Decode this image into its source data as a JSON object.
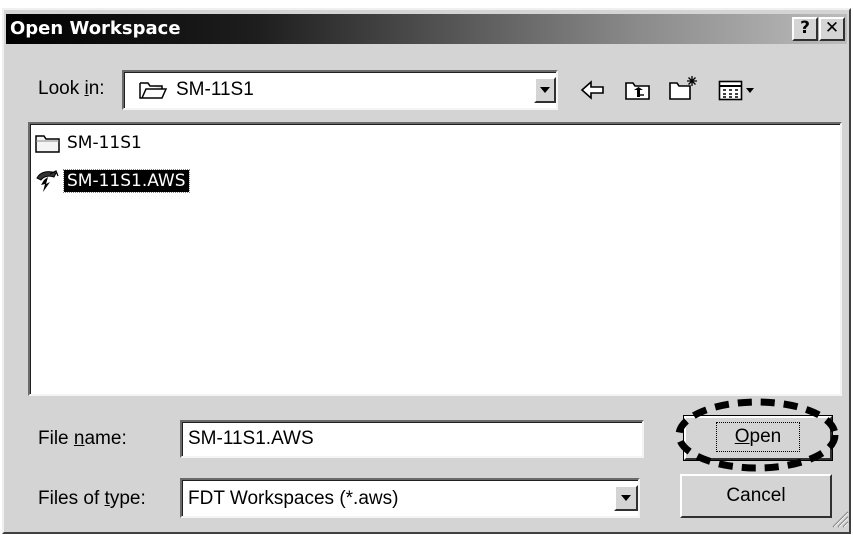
{
  "window": {
    "title": "Open Workspace",
    "help_button": "?",
    "close_button": "✕"
  },
  "lookin": {
    "label_pre": "Look ",
    "label_hot": "i",
    "label_post": "n:",
    "value": "SM-11S1"
  },
  "files": [
    {
      "name": "SM-11S1",
      "icon": "folder-icon",
      "selected": false
    },
    {
      "name": "SM-11S1.AWS",
      "icon": "workspace-file-icon",
      "selected": true
    }
  ],
  "filename": {
    "label_pre": "File ",
    "label_hot": "n",
    "label_post": "ame:",
    "value": "SM-11S1.AWS"
  },
  "filetype": {
    "label_pre": "Files of ",
    "label_hot": "t",
    "label_post": "ype:",
    "value": "FDT Workspaces (*.aws)"
  },
  "buttons": {
    "open_hot": "O",
    "open_rest": "pen",
    "cancel": "Cancel"
  },
  "toolbar_icons": [
    "back-arrow-icon",
    "up-folder-icon",
    "new-folder-icon",
    "view-menu-icon"
  ],
  "colors": {
    "dialog_face": "#d4d4d4",
    "titlebar_dark": "#000000",
    "selection": "#000000"
  }
}
